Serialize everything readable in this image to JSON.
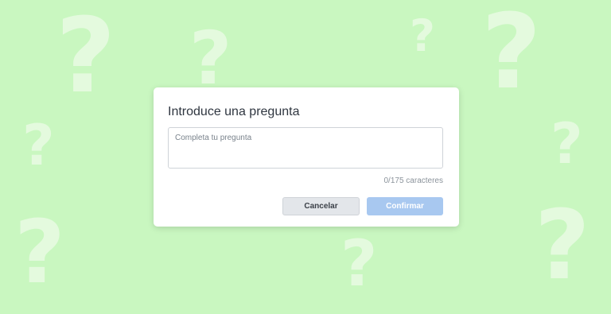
{
  "dialog": {
    "title": "Introduce una pregunta",
    "input": {
      "placeholder": "Completa tu pregunta",
      "value": ""
    },
    "counter": "0/175 caracteres",
    "cancel_label": "Cancelar",
    "confirm_label": "Confirmar"
  },
  "colors": {
    "background": "#c9f7c0",
    "confirm_disabled": "#a8c8f0"
  },
  "background_icon": "question-mark-icon"
}
